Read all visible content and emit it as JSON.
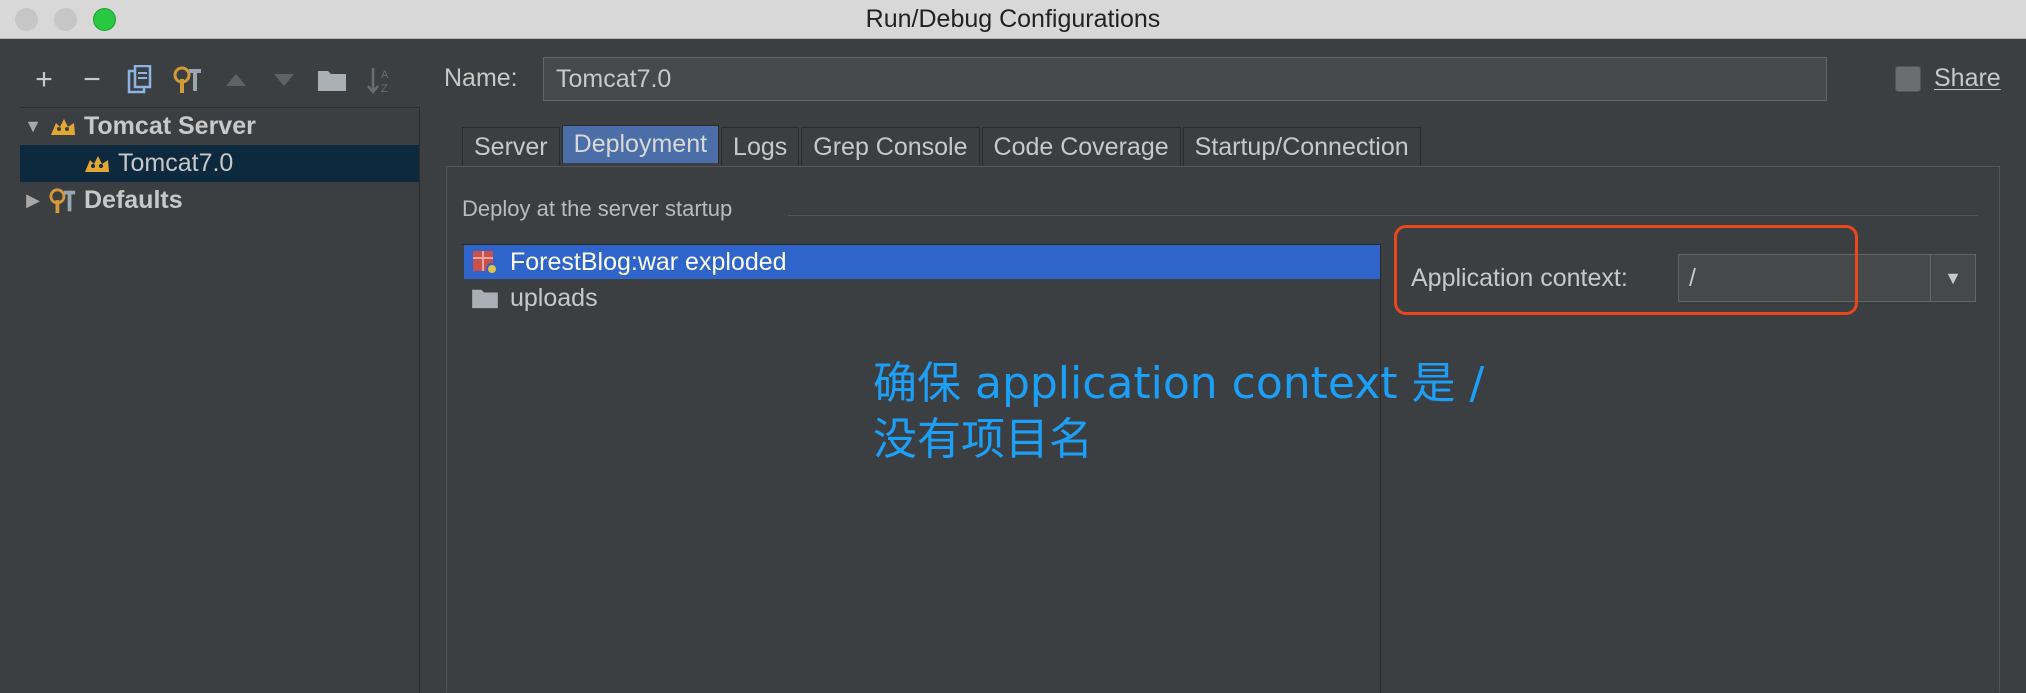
{
  "window": {
    "title": "Run/Debug Configurations",
    "controls": [
      "close",
      "minimize",
      "maximize"
    ]
  },
  "toolbar": {
    "buttons": [
      {
        "icon": "plus-icon",
        "label": "+"
      },
      {
        "icon": "minus-icon",
        "label": "−"
      },
      {
        "icon": "copy-icon"
      },
      {
        "icon": "wrench-icon"
      },
      {
        "icon": "move-up-icon"
      },
      {
        "icon": "move-down-icon"
      },
      {
        "icon": "folder-icon"
      },
      {
        "icon": "sort-az-icon"
      }
    ]
  },
  "tree": {
    "items": [
      {
        "label": "Tomcat Server",
        "expanded": true,
        "icon": "tomcat-icon"
      },
      {
        "label": "Tomcat7.0",
        "selected": true,
        "icon": "tomcat-icon"
      },
      {
        "label": "Defaults",
        "expanded": false,
        "icon": "wrench-icon"
      }
    ]
  },
  "config": {
    "name_label": "Name:",
    "name_value": "Tomcat7.0",
    "share_label": "Share",
    "share_checked": false
  },
  "tabs": [
    {
      "label": "Server"
    },
    {
      "label": "Deployment",
      "active": true
    },
    {
      "label": "Logs"
    },
    {
      "label": "Grep Console"
    },
    {
      "label": "Code Coverage"
    },
    {
      "label": "Startup/Connection"
    }
  ],
  "deployment": {
    "section_label": "Deploy at the server startup",
    "artifacts": [
      {
        "label": "ForestBlog:war exploded",
        "selected": true,
        "icon": "war-artifact-icon"
      },
      {
        "label": "uploads",
        "icon": "folder-icon"
      }
    ],
    "context_label": "Application context:",
    "context_value": "/"
  },
  "annotation": {
    "line1": "确保 application context 是 /",
    "line2": "没有项目名",
    "highlight_color": "#e8481c",
    "text_color": "#1c9ff7"
  },
  "colors": {
    "background": "#3c3f41",
    "selection": "#2f65ca",
    "tab_active": "#4b6ea8",
    "tree_selection": "#0d293e"
  }
}
